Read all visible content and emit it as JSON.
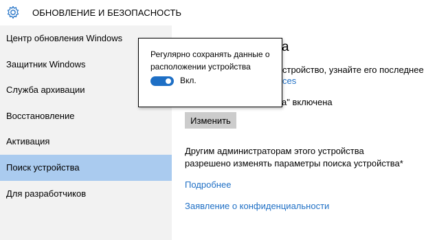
{
  "header": {
    "icon": "gear-icon",
    "title": "ОБНОВЛЕНИЕ И БЕЗОПАСНОСТЬ"
  },
  "sidebar": {
    "items": [
      {
        "label": "Центр обновления Windows"
      },
      {
        "label": "Защитник Windows"
      },
      {
        "label": "Служба архивации"
      },
      {
        "label": "Восстановление"
      },
      {
        "label": "Активация"
      },
      {
        "label": "Поиск устройства",
        "selected": true
      },
      {
        "label": "Для разработчиков"
      }
    ]
  },
  "main": {
    "heading_fragment": "а",
    "line1_fragment": "стройство, узнайте его последнее изв...",
    "link_fragment": "ces",
    "status_fragment": "а\" включена",
    "change_button": "Изменить",
    "paragraph": "Другим администраторам этого устройства разрешено изменять параметры поиска устройства*",
    "more_link": "Подробнее",
    "privacy_link": "Заявление о конфиденциальности"
  },
  "popup": {
    "text": "Регулярно сохранять данные о расположении устройства",
    "toggle_state": "on",
    "toggle_label": "Вкл."
  },
  "colors": {
    "accent": "#1e6fc5",
    "selected_bg": "#aacbef",
    "sidebar_bg": "#f2f2f2",
    "button_bg": "#cccccc"
  }
}
